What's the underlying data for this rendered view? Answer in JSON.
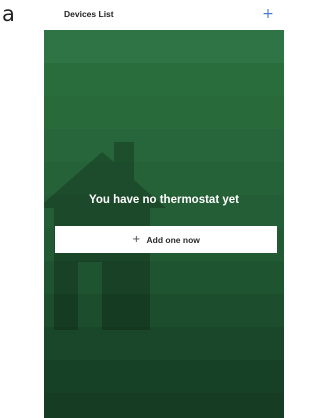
{
  "figure": {
    "panel_letter": "a"
  },
  "nav": {
    "title": "Devices List",
    "add_icon": "plus-icon",
    "add_icon_glyph": "+"
  },
  "empty_state": {
    "message": "You have no thermostat yet",
    "button_icon_glyph": "+",
    "button_label": "Add one now",
    "background_icon": "house-icon"
  },
  "colors": {
    "background_green": "#2c6f3f",
    "band_colors": [
      "#2f7444",
      "#2a6d3d",
      "#296a3b",
      "#27663a",
      "#256238",
      "#235e36",
      "#215a33",
      "#1f5431",
      "#1c4e2d",
      "#1a472a",
      "#174126",
      "#173c24"
    ],
    "accent_blue": "#4a7bd0",
    "button_white": "#ffffff"
  }
}
